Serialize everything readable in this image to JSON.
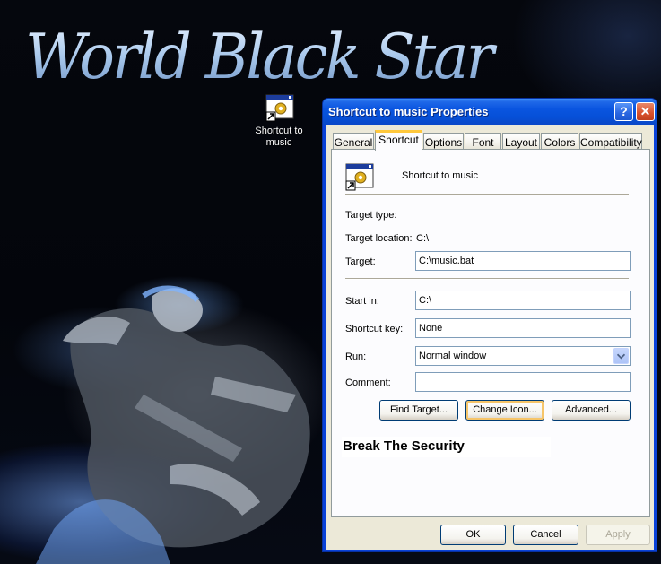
{
  "wallpaper": {
    "title_art": "World Black Star",
    "art": "skeletal-rider-on-beast"
  },
  "desktop": {
    "icon_label": "Shortcut to music",
    "icon": "batch-file-shortcut-icon"
  },
  "window": {
    "title": "Shortcut to music Properties",
    "help_glyph": "?",
    "close_glyph": "✕"
  },
  "tabs": [
    {
      "label": "General"
    },
    {
      "label": "Shortcut",
      "active": true
    },
    {
      "label": "Options"
    },
    {
      "label": "Font"
    },
    {
      "label": "Layout"
    },
    {
      "label": "Colors"
    },
    {
      "label": "Compatibility"
    }
  ],
  "shortcut": {
    "name": "Shortcut to music",
    "target_type_label": "Target type:",
    "target_type_value": "",
    "target_location_label": "Target location:",
    "target_location_value": "C:\\",
    "target_label": "Target:",
    "target_value": "C:\\music.bat",
    "start_in_label": "Start in:",
    "start_in_value": "C:\\",
    "shortcut_key_label": "Shortcut key:",
    "shortcut_key_value": "None",
    "run_label": "Run:",
    "run_value": "Normal window",
    "comment_label": "Comment:",
    "comment_value": "",
    "find_target_label": "Find Target...",
    "change_icon_label": "Change Icon...",
    "advanced_label": "Advanced...",
    "note_text": "Break The Security"
  },
  "footer": {
    "ok_label": "OK",
    "cancel_label": "Cancel",
    "apply_label": "Apply"
  },
  "colors": {
    "titlebar": "#0650d8",
    "dialog_face": "#ece9d8",
    "tab_highlight": "#ffc83c"
  }
}
